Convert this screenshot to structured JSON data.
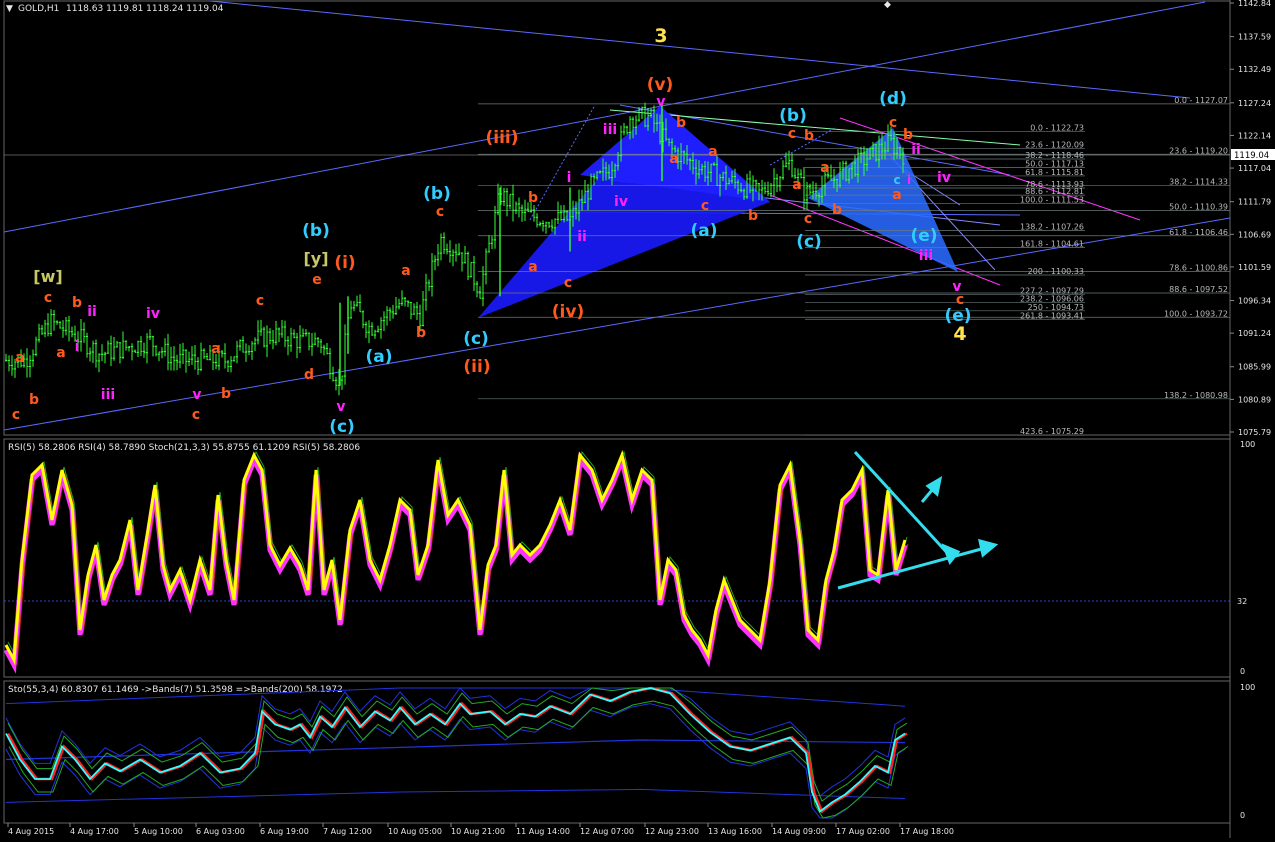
{
  "window": {
    "symbol_title": "GOLD,H1",
    "ohlc": "1118.63 1119.81 1118.24 1119.04"
  },
  "price_axis": {
    "ticks": [
      "1142.84",
      "1137.59",
      "1132.49",
      "1127.24",
      "1122.14",
      "1117.04",
      "1111.79",
      "1106.69",
      "1101.59",
      "1096.34",
      "1091.24",
      "1085.99",
      "1080.89",
      "1075.79"
    ],
    "current_price": "1119.04",
    "ylim": [
      1075.79,
      1142.84
    ]
  },
  "time_axis": {
    "ticks": [
      "4 Aug 2015",
      "4 Aug 17:00",
      "5 Aug 10:00",
      "6 Aug 03:00",
      "6 Aug 19:00",
      "7 Aug 12:00",
      "10 Aug 05:00",
      "10 Aug 21:00",
      "11 Aug 14:00",
      "12 Aug 07:00",
      "12 Aug 23:00",
      "13 Aug 16:00",
      "14 Aug 09:00",
      "17 Aug 02:00",
      "17 Aug 18:00"
    ]
  },
  "fibonacci": {
    "inner": [
      "0.0 - 1122.73",
      "23.6 - 1120.09",
      "38.2 - 1118.46",
      "50.0 - 1117.13",
      "61.8 - 1115.81",
      "78.6 - 1113.93",
      "88.6 - 1112.81",
      "100.0 - 1111.53",
      "138.2 - 1107.26",
      "161.8 - 1104.61",
      "200 - 1100.33",
      "227.2 - 1097.29",
      "238.2 - 1096.06",
      "250 - 1094.73",
      "261.8 - 1093.41",
      "423.6 - 1075.29"
    ],
    "outer": [
      "0.0 - 1127.07",
      "23.6 - 1119.20",
      "38.2 - 1114.33",
      "50.0 - 1110.39",
      "61.8 - 1106.46",
      "78.6 - 1100.86",
      "88.6 - 1097.52",
      "100.0 - 1093.72",
      "138.2 - 1080.98"
    ]
  },
  "wave_labels": {
    "w_major": "[w]",
    "y_major": "[y]",
    "three": "3",
    "four": "4",
    "v_paren": "(v)",
    "iii_paren": "(iii)",
    "ii_paren": "(ii)",
    "iv_paren": "(iv)",
    "i_paren": "(i)",
    "a_p": "(a)",
    "b_p": "(b)",
    "c_p": "(c)",
    "d_p": "(d)",
    "e_p": "(e)",
    "a": "a",
    "b": "b",
    "c": "c",
    "d": "d",
    "e": "e",
    "i": "i",
    "ii": "ii",
    "iii": "iii",
    "iv": "iv",
    "v": "v"
  },
  "indicators": {
    "rsi_header": "RSI(5) 58.2806  RSI(4) 58.7890  Stoch(21,3,3) 55.8755 61.1209  RSI(5) 58.2806",
    "rsi_levels": [
      "100",
      "32",
      "0"
    ],
    "sto_header": "Sto(55,3,4) 60.8307 61.1469  ->Bands(7) 51.3598  =>Bands(200) 58.1972",
    "sto_levels": [
      "100",
      "0"
    ]
  },
  "colors": {
    "candle": "#33ff33",
    "wave_orange": "#ff5a1e",
    "wave_magenta": "#ff22ff",
    "wave_cyan": "#33ccff",
    "wave_yellow": "#ffe34d",
    "wave_olive": "#c8c864",
    "channel": "#5a6aff",
    "rsi_yellow": "#ffff00",
    "rsi_magenta": "#ff33ff",
    "arrow": "#33ddee",
    "sto_cyan": "#33ffff",
    "sto_red": "#ff2222",
    "band_blue": "#2233dd"
  },
  "chart_data": {
    "type": "candlestick",
    "title": "GOLD,H1",
    "ylim": [
      1075.79,
      1142.84
    ],
    "close_path": [
      [
        0,
        1087
      ],
      [
        25,
        1087
      ],
      [
        50,
        1093
      ],
      [
        75,
        1091
      ],
      [
        100,
        1088
      ],
      [
        125,
        1089
      ],
      [
        150,
        1090
      ],
      [
        175,
        1087
      ],
      [
        200,
        1087
      ],
      [
        225,
        1087
      ],
      [
        250,
        1090
      ],
      [
        275,
        1091
      ],
      [
        300,
        1090
      ],
      [
        320,
        1090
      ],
      [
        340,
        1083
      ],
      [
        350,
        1096
      ],
      [
        370,
        1092
      ],
      [
        400,
        1096
      ],
      [
        420,
        1094
      ],
      [
        440,
        1106
      ],
      [
        460,
        1104
      ],
      [
        480,
        1098
      ],
      [
        500,
        1113
      ],
      [
        520,
        1110
      ],
      [
        545,
        1109
      ],
      [
        570,
        1109
      ],
      [
        590,
        1114
      ],
      [
        610,
        1117
      ],
      [
        630,
        1125
      ],
      [
        650,
        1125
      ],
      [
        670,
        1120
      ],
      [
        700,
        1117
      ],
      [
        730,
        1115
      ],
      [
        760,
        1113
      ],
      [
        790,
        1118
      ],
      [
        805,
        1113
      ],
      [
        830,
        1115
      ],
      [
        860,
        1118
      ],
      [
        890,
        1121
      ],
      [
        905,
        1119
      ]
    ]
  }
}
